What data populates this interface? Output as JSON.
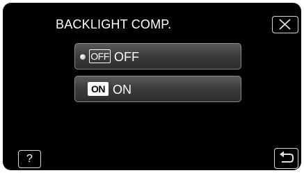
{
  "header": {
    "title": "BACKLIGHT COMP."
  },
  "options": [
    {
      "badge": "OFF",
      "label": "OFF",
      "selected": true
    },
    {
      "badge": "ON",
      "label": "ON",
      "selected": false
    }
  ],
  "footer": {
    "help_label": "?"
  },
  "icons": {
    "close": "close-icon",
    "back": "back-icon",
    "selection": "bullet-icon"
  },
  "colors": {
    "background": "#000000",
    "text": "#ffffff",
    "button_border": "#d8d8d8"
  }
}
